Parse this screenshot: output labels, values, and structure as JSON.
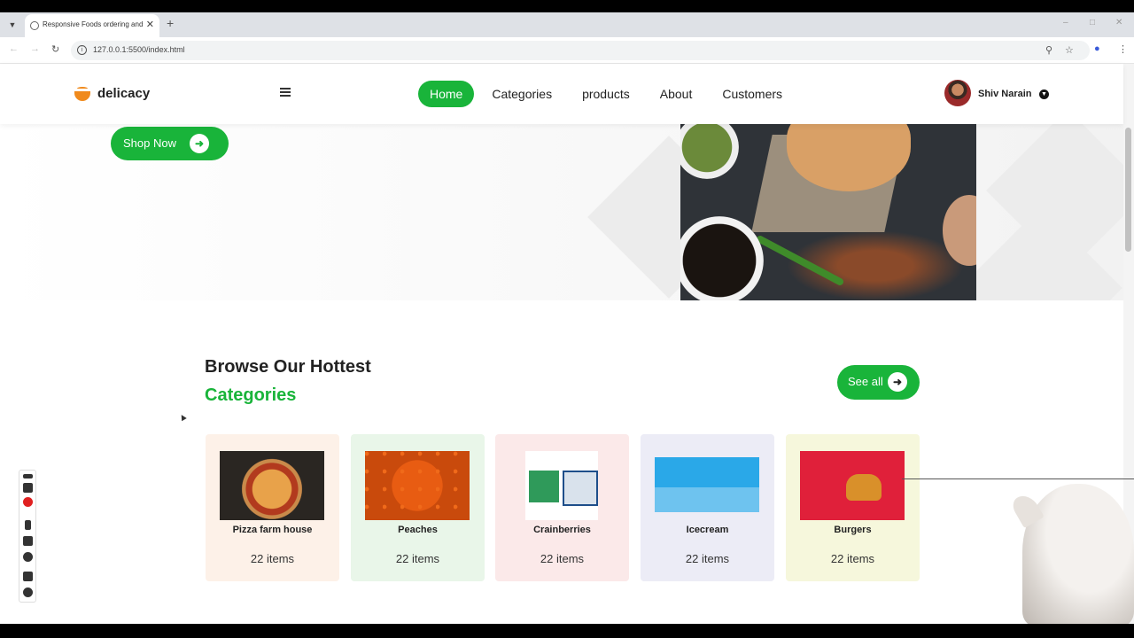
{
  "browser": {
    "tab_title": "Responsive Foods ordering and",
    "url": "127.0.0.1:5500/index.html"
  },
  "header": {
    "logo_text": "delicacy",
    "nav": [
      {
        "label": "Home",
        "active": true
      },
      {
        "label": "Categories",
        "active": false
      },
      {
        "label": "products",
        "active": false
      },
      {
        "label": "About",
        "active": false
      },
      {
        "label": "Customers",
        "active": false
      }
    ],
    "user_name": "Shiv Narain"
  },
  "hero": {
    "shop_button_label": "Shop Now"
  },
  "categories_section": {
    "title_line1": "Browse Our Hottest",
    "title_line2": "Categories",
    "see_all_label": "See all",
    "items": [
      {
        "name": "Pizza farm house",
        "count": "22 items",
        "bg": "#fdf1e8"
      },
      {
        "name": "Peaches",
        "count": "22 items",
        "bg": "#e9f6e9"
      },
      {
        "name": "Crainberries",
        "count": "22 items",
        "bg": "#fbe9e9"
      },
      {
        "name": "Icecream",
        "count": "22 items",
        "bg": "#ececf6"
      },
      {
        "name": "Burgers",
        "count": "22 items",
        "bg": "#f6f7dc"
      }
    ]
  },
  "colors": {
    "accent": "#19b43a",
    "logo_orange": "#f08a1c"
  }
}
